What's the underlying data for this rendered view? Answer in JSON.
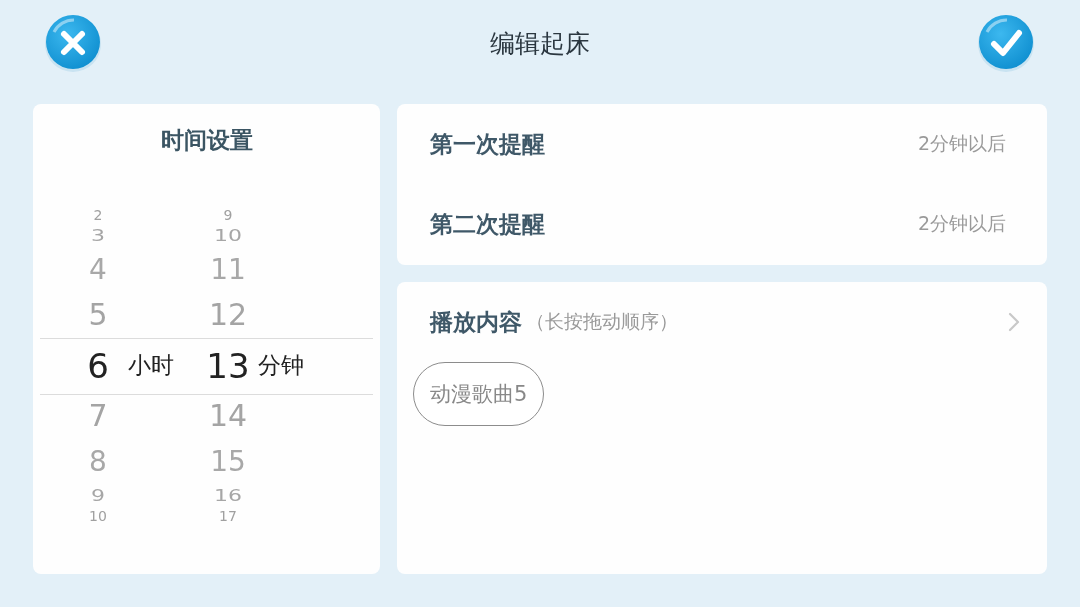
{
  "header": {
    "title": "编辑起床"
  },
  "time_settings": {
    "title": "时间设置",
    "columns": [
      {
        "unit": "小时",
        "items": [
          {
            "label": "2",
            "selected": false
          },
          {
            "label": "3",
            "selected": false
          },
          {
            "label": "4",
            "selected": false
          },
          {
            "label": "5",
            "selected": false
          },
          {
            "label": "6",
            "selected": true
          },
          {
            "label": "7",
            "selected": false
          },
          {
            "label": "8",
            "selected": false
          },
          {
            "label": "9",
            "selected": false
          },
          {
            "label": "10",
            "selected": false
          }
        ]
      },
      {
        "unit": "分钟",
        "items": [
          {
            "label": "9",
            "selected": false
          },
          {
            "label": "10",
            "selected": false
          },
          {
            "label": "11",
            "selected": false
          },
          {
            "label": "12",
            "selected": false
          },
          {
            "label": "13",
            "selected": true
          },
          {
            "label": "14",
            "selected": false
          },
          {
            "label": "15",
            "selected": false
          },
          {
            "label": "16",
            "selected": false
          },
          {
            "label": "17",
            "selected": false
          }
        ]
      }
    ]
  },
  "reminders": [
    {
      "label": "第一次提醒",
      "value": "2分钟以后"
    },
    {
      "label": "第二次提醒",
      "value": "2分钟以后"
    }
  ],
  "playlist": {
    "title": "播放内容",
    "hint": "（长按拖动顺序）",
    "items": [
      "动漫歌曲5"
    ]
  }
}
